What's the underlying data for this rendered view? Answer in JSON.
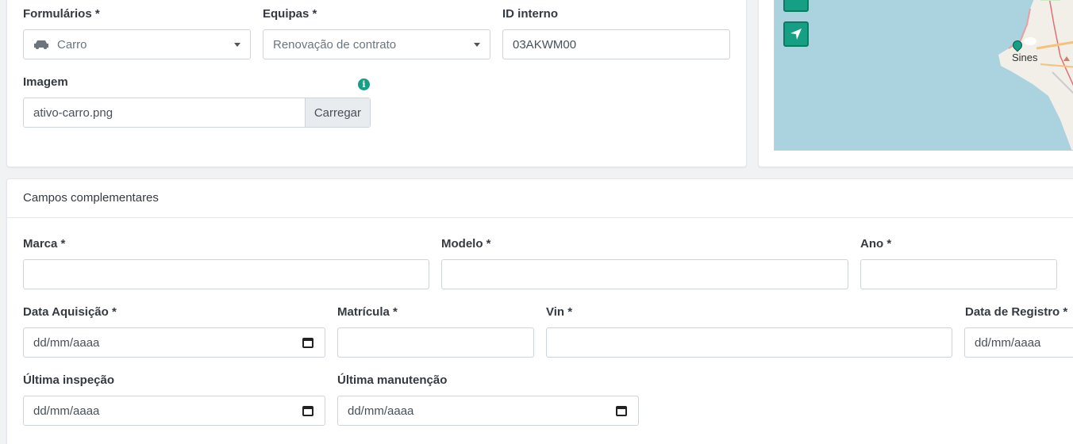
{
  "form": {
    "formularios": {
      "label": "Formulários *",
      "value": "Carro",
      "icon": "car-icon"
    },
    "equipas": {
      "label": "Equipas *",
      "value": "Renovação de contrato"
    },
    "id_interno": {
      "label": "ID interno",
      "value": "03AKWM00"
    },
    "imagem": {
      "label": "Imagem",
      "value": "ativo-carro.png",
      "button": "Carregar",
      "info_icon": "i"
    }
  },
  "map": {
    "place_label": "Sines",
    "land_color": "#f2efe9",
    "water_color": "#aad3df"
  },
  "complementares": {
    "title": "Campos complementares",
    "marca": {
      "label": "Marca *",
      "value": ""
    },
    "modelo": {
      "label": "Modelo *",
      "value": ""
    },
    "ano": {
      "label": "Ano *",
      "value": ""
    },
    "data_aquisicao": {
      "label": "Data Aquisição *",
      "placeholder": "dd/mm/aaaa"
    },
    "matricula": {
      "label": "Matrícula *",
      "value": ""
    },
    "vin": {
      "label": "Vin *",
      "value": ""
    },
    "data_registro": {
      "label": "Data de Registro *",
      "placeholder": "dd/mm/aaaa"
    },
    "ultima_inspecao": {
      "label": "Última inspeção",
      "placeholder": "dd/mm/aaaa"
    },
    "ultima_manutencao": {
      "label": "Última manutenção",
      "placeholder": "dd/mm/aaaa"
    }
  },
  "colors": {
    "accent": "#15a085",
    "border": "#ced4da",
    "background": "#f0f2f4"
  }
}
